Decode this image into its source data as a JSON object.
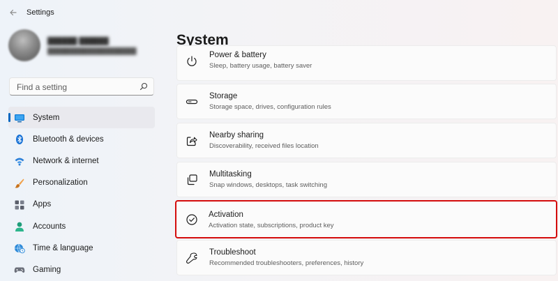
{
  "window": {
    "title": "Settings"
  },
  "search": {
    "placeholder": "Find a setting"
  },
  "sidebar": {
    "items": [
      {
        "label": "System",
        "icon": "monitor-icon",
        "active": true
      },
      {
        "label": "Bluetooth & devices",
        "icon": "bluetooth-icon"
      },
      {
        "label": "Network & internet",
        "icon": "wifi-icon"
      },
      {
        "label": "Personalization",
        "icon": "brush-icon"
      },
      {
        "label": "Apps",
        "icon": "apps-icon"
      },
      {
        "label": "Accounts",
        "icon": "person-icon"
      },
      {
        "label": "Time & language",
        "icon": "globe-clock-icon"
      },
      {
        "label": "Gaming",
        "icon": "gamepad-icon"
      }
    ]
  },
  "main": {
    "title": "System",
    "cards": [
      {
        "title": "Power & battery",
        "subtitle": "Sleep, battery usage, battery saver",
        "icon": "power-icon"
      },
      {
        "title": "Storage",
        "subtitle": "Storage space, drives, configuration rules",
        "icon": "storage-icon"
      },
      {
        "title": "Nearby sharing",
        "subtitle": "Discoverability, received files location",
        "icon": "share-icon"
      },
      {
        "title": "Multitasking",
        "subtitle": "Snap windows, desktops, task switching",
        "icon": "multitasking-icon"
      },
      {
        "title": "Activation",
        "subtitle": "Activation state, subscriptions, product key",
        "icon": "check-circle-icon",
        "highlighted": true
      },
      {
        "title": "Troubleshoot",
        "subtitle": "Recommended troubleshooters, preferences, history",
        "icon": "wrench-icon"
      }
    ]
  },
  "colors": {
    "accent": "#0067c0",
    "highlight_border": "#d40c0c"
  }
}
